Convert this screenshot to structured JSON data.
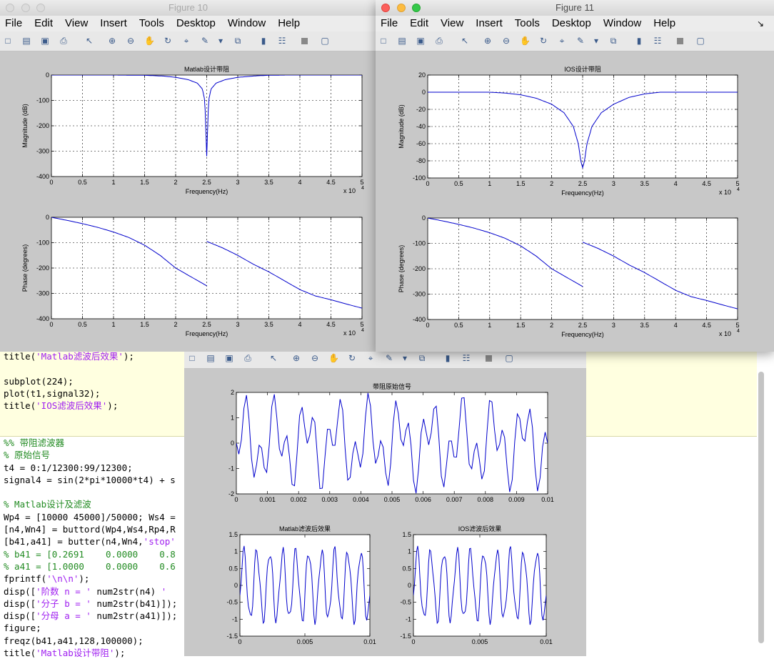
{
  "menu": [
    "File",
    "Edit",
    "View",
    "Insert",
    "Tools",
    "Desktop",
    "Window",
    "Help"
  ],
  "editor": {
    "lines_top": [
      [
        [
          "t",
          "title("
        ],
        [
          "s",
          "'Matlab滤波后效果'"
        ],
        [
          "t",
          ");"
        ]
      ],
      [],
      [
        [
          "t",
          "subplot(224);"
        ]
      ],
      [
        [
          "t",
          "plot(t1,signal32);"
        ]
      ],
      [
        [
          "t",
          "title("
        ],
        [
          "s",
          "'IOS滤波后效果'"
        ],
        [
          "t",
          ");"
        ]
      ]
    ],
    "lines_bottom": [
      [
        [
          "c",
          "%% 带阻滤波器"
        ]
      ],
      [
        [
          "c",
          "% 原始信号"
        ]
      ],
      [
        [
          "t",
          "t4 = 0:1/12300:99/12300;"
        ]
      ],
      [
        [
          "t",
          "signal4 = sin(2*pi*10000*t4) + s"
        ]
      ],
      [],
      [
        [
          "c",
          "% Matlab设计及滤波"
        ]
      ],
      [
        [
          "t",
          "Wp4 = [10000 45000]/50000; Ws4 ="
        ]
      ],
      [
        [
          "t",
          "[n4,Wn4] = buttord(Wp4,Ws4,Rp4,R"
        ]
      ],
      [
        [
          "t",
          "[b41,a41] = butter(n4,Wn4,"
        ],
        [
          "s",
          "'stop'"
        ]
      ],
      [
        [
          "c",
          "% b41 = [0.2691    0.0000    0.8"
        ]
      ],
      [
        [
          "c",
          "% a41 = [1.0000    0.0000    0.6"
        ]
      ],
      [
        [
          "t",
          "fprintf("
        ],
        [
          "s",
          "'\\n\\n'"
        ],
        [
          "t",
          ");"
        ]
      ],
      [
        [
          "t",
          "disp(["
        ],
        [
          "s",
          "'阶数 n = '"
        ],
        [
          "t",
          " num2str(n4) "
        ],
        [
          "s",
          "'"
        ]
      ],
      [
        [
          "t",
          "disp(["
        ],
        [
          "s",
          "'分子 b = '"
        ],
        [
          "t",
          " num2str(b41)]);"
        ]
      ],
      [
        [
          "t",
          "disp(["
        ],
        [
          "s",
          "'分母 a = '"
        ],
        [
          "t",
          " num2str(a41)]);"
        ]
      ],
      [
        [
          "t",
          "figure;"
        ]
      ],
      [
        [
          "t",
          "freqz(b41,a41,128,100000);"
        ]
      ],
      [
        [
          "t",
          "title("
        ],
        [
          "s",
          "'Matlab设计带阻'"
        ],
        [
          "t",
          ");"
        ]
      ]
    ]
  },
  "fig10": {
    "title": "Figure 10",
    "mag": {
      "title": "Matlab设计带阻",
      "ylabel": "Magnitude (dB)",
      "xlabel": "Frequency(Hz)",
      "exp": "x 10",
      "exp_sup": "4",
      "yticks": [
        "0",
        "-100",
        "-200",
        "-300",
        "-400"
      ],
      "xticks": [
        "0",
        "0.5",
        "1",
        "1.5",
        "2",
        "2.5",
        "3",
        "3.5",
        "4",
        "4.5",
        "5"
      ],
      "ylim": [
        -400,
        0
      ],
      "xlim": [
        0,
        50000
      ]
    },
    "phase": {
      "ylabel": "Phase (degrees)",
      "xlabel": "Frequency(Hz)",
      "exp": "x 10",
      "exp_sup": "4",
      "yticks": [
        "0",
        "-100",
        "-200",
        "-300",
        "-400"
      ],
      "xticks": [
        "0",
        "0.5",
        "1",
        "1.5",
        "2",
        "2.5",
        "3",
        "3.5",
        "4",
        "4.5",
        "5"
      ],
      "ylim": [
        -400,
        0
      ],
      "xlim": [
        0,
        50000
      ]
    }
  },
  "fig11": {
    "title": "Figure 11",
    "mag": {
      "title": "IOS设计带阻",
      "ylabel": "Magnitude (dB)",
      "xlabel": "Frequency(Hz)",
      "exp": "x 10",
      "exp_sup": "4",
      "yticks": [
        "20",
        "0",
        "-20",
        "-40",
        "-60",
        "-80",
        "-100"
      ],
      "xticks": [
        "0",
        "0.5",
        "1",
        "1.5",
        "2",
        "2.5",
        "3",
        "3.5",
        "4",
        "4.5",
        "5"
      ],
      "ylim": [
        -100,
        20
      ],
      "xlim": [
        0,
        50000
      ]
    },
    "phase": {
      "ylabel": "Phase (degrees)",
      "xlabel": "Frequency(Hz)",
      "exp": "x 10",
      "exp_sup": "4",
      "yticks": [
        "0",
        "-100",
        "-200",
        "-300",
        "-400"
      ],
      "xticks": [
        "0",
        "0.5",
        "1",
        "1.5",
        "2",
        "2.5",
        "3",
        "3.5",
        "4",
        "4.5",
        "5"
      ],
      "ylim": [
        -400,
        0
      ],
      "xlim": [
        0,
        50000
      ]
    }
  },
  "fig_signal": {
    "top": {
      "title": "带阻原始信号",
      "yticks": [
        "2",
        "1",
        "0",
        "-1",
        "-2"
      ],
      "xticks": [
        "0",
        "0.001",
        "0.002",
        "0.003",
        "0.004",
        "0.005",
        "0.006",
        "0.007",
        "0.008",
        "0.009",
        "0.01"
      ],
      "ylim": [
        -2,
        2
      ],
      "xlim": [
        0,
        0.01
      ]
    },
    "left": {
      "title": "Matlab滤波后效果",
      "yticks": [
        "1.5",
        "1",
        "0.5",
        "0",
        "-0.5",
        "-1",
        "-1.5"
      ],
      "xticks": [
        "0",
        "0.005",
        "0.01"
      ],
      "ylim": [
        -1.5,
        1.5
      ],
      "xlim": [
        0,
        0.01
      ]
    },
    "right": {
      "title": "IOS滤波后效果",
      "yticks": [
        "1.5",
        "1",
        "0.5",
        "0",
        "-0.5",
        "-1",
        "-1.5"
      ],
      "xticks": [
        "0",
        "0.005",
        "0.01"
      ],
      "ylim": [
        -1.5,
        1.5
      ],
      "xlim": [
        0,
        0.01
      ]
    }
  },
  "chart_data": [
    {
      "type": "line",
      "title": "Matlab设计带阻",
      "xlabel": "Frequency(Hz)",
      "ylabel": "Magnitude (dB)",
      "xlim": [
        0,
        50000
      ],
      "ylim": [
        -400,
        0
      ],
      "grid": true,
      "series": [
        {
          "x": [
            0,
            10000,
            15000,
            18000,
            20000,
            22000,
            23500,
            24300,
            24700,
            25000,
            25300,
            25700,
            26500,
            28000,
            30000,
            33000,
            35000,
            38000,
            50000
          ],
          "y": [
            0,
            0,
            -1,
            -4,
            -9,
            -18,
            -32,
            -55,
            -100,
            -320,
            -100,
            -55,
            -32,
            -18,
            -9,
            -3,
            -1,
            0,
            0
          ]
        }
      ]
    },
    {
      "type": "line",
      "xlabel": "Frequency(Hz)",
      "ylabel": "Phase (degrees)",
      "xlim": [
        0,
        50000
      ],
      "ylim": [
        -400,
        0
      ],
      "grid": true,
      "series": [
        {
          "x": [
            0,
            2500,
            5000,
            7500,
            10000,
            12500,
            15000,
            17500,
            20000,
            22500,
            25000,
            25000,
            27500,
            30000,
            32500,
            35000,
            37500,
            40000,
            42500,
            45000,
            47500,
            50000
          ],
          "y": [
            0,
            -12,
            -25,
            -40,
            -58,
            -80,
            -110,
            -150,
            -200,
            -235,
            -270,
            -95,
            -120,
            -150,
            -185,
            -215,
            -250,
            -285,
            -310,
            -325,
            -342,
            -358
          ]
        }
      ]
    },
    {
      "type": "line",
      "title": "IOS设计带阻",
      "xlabel": "Frequency(Hz)",
      "ylabel": "Magnitude (dB)",
      "xlim": [
        0,
        50000
      ],
      "ylim": [
        -100,
        20
      ],
      "grid": true,
      "series": [
        {
          "x": [
            0,
            10000,
            12500,
            15000,
            17500,
            20000,
            22000,
            23500,
            24300,
            24700,
            25000,
            25300,
            25700,
            26500,
            28000,
            30000,
            32500,
            35000,
            37500,
            50000
          ],
          "y": [
            0,
            0,
            -1,
            -3,
            -7,
            -14,
            -24,
            -40,
            -60,
            -80,
            -88,
            -80,
            -60,
            -40,
            -24,
            -14,
            -6,
            -2,
            0,
            0
          ]
        }
      ]
    },
    {
      "type": "line",
      "xlabel": "Frequency(Hz)",
      "ylabel": "Phase (degrees)",
      "xlim": [
        0,
        50000
      ],
      "ylim": [
        -400,
        0
      ],
      "grid": true,
      "series": [
        {
          "x": [
            0,
            2500,
            5000,
            7500,
            10000,
            12500,
            15000,
            17500,
            20000,
            22500,
            25000,
            25000,
            27500,
            30000,
            32500,
            35000,
            37500,
            40000,
            42500,
            45000,
            47500,
            50000
          ],
          "y": [
            0,
            -12,
            -25,
            -40,
            -58,
            -80,
            -110,
            -150,
            -200,
            -235,
            -270,
            -95,
            -120,
            -150,
            -185,
            -215,
            -250,
            -285,
            -310,
            -325,
            -342,
            -358
          ]
        }
      ]
    },
    {
      "type": "line",
      "title": "带阻原始信号",
      "xlim": [
        0,
        0.01
      ],
      "ylim": [
        -2,
        2
      ],
      "series": [
        {
          "formula": "sin(2*pi*10000*t)+sin(2*pi*1000*t), sampled at 12300 Hz",
          "t_range": [
            0,
            0.01
          ]
        }
      ]
    },
    {
      "type": "line",
      "title": "Matlab滤波后效果",
      "xlim": [
        0,
        0.01
      ],
      "ylim": [
        -1.5,
        1.5
      ],
      "series": [
        {
          "formula": "approx sin(2*pi*1000*t) with small ripple",
          "t_range": [
            0,
            0.01
          ]
        }
      ]
    },
    {
      "type": "line",
      "title": "IOS滤波后效果",
      "xlim": [
        0,
        0.01
      ],
      "ylim": [
        -1.5,
        1.5
      ],
      "series": [
        {
          "formula": "approx sin(2*pi*1000*t) with small ripple",
          "t_range": [
            0,
            0.01
          ]
        }
      ]
    }
  ]
}
